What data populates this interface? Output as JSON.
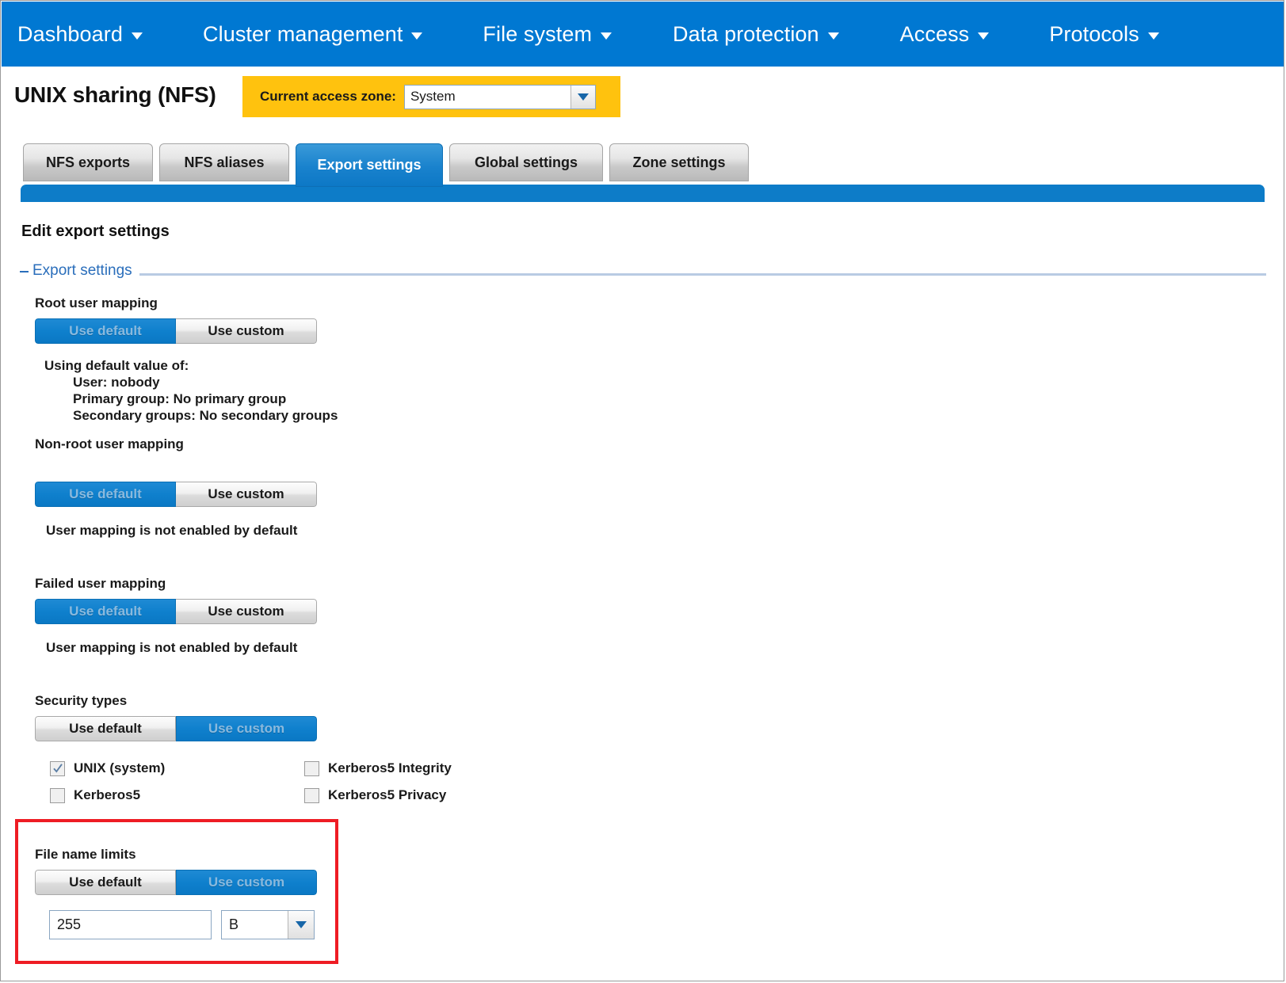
{
  "nav": {
    "items": [
      {
        "label": "Dashboard",
        "icon": "chevron-down-icon"
      },
      {
        "label": "Cluster management",
        "icon": "chevron-down-icon"
      },
      {
        "label": "File system",
        "icon": "chevron-down-icon"
      },
      {
        "label": "Data protection",
        "icon": "chevron-down-icon"
      },
      {
        "label": "Access",
        "icon": "chevron-down-icon"
      },
      {
        "label": "Protocols",
        "icon": "chevron-down-icon"
      }
    ]
  },
  "header": {
    "title": "UNIX sharing (NFS)",
    "zone": {
      "label": "Current access zone:",
      "value": "System",
      "icon": "chevron-down-icon"
    }
  },
  "tabs": [
    {
      "label": "NFS exports",
      "active": false
    },
    {
      "label": "NFS aliases",
      "active": false
    },
    {
      "label": "Export settings",
      "active": true
    },
    {
      "label": "Global settings",
      "active": false
    },
    {
      "label": "Zone settings",
      "active": false
    }
  ],
  "main": {
    "heading": "Edit export settings",
    "fieldset_legend": "Export settings",
    "toggle": {
      "default_label": "Use default",
      "custom_label": "Use custom"
    },
    "sections": {
      "root_user_mapping": {
        "label": "Root user mapping",
        "selected": "Use default",
        "helper_lines": [
          "Using default value of:",
          "User: nobody",
          "Primary group: No primary group",
          "Secondary groups: No secondary groups"
        ]
      },
      "non_root_user_mapping": {
        "label": "Non-root user mapping",
        "selected": "Use default",
        "helper": "User mapping is not enabled by default"
      },
      "failed_user_mapping": {
        "label": "Failed user mapping",
        "selected": "Use default",
        "helper": "User mapping is not enabled by default"
      },
      "security_types": {
        "label": "Security types",
        "selected": "Use custom",
        "options": [
          {
            "label": "UNIX (system)",
            "checked": true
          },
          {
            "label": "Kerberos5",
            "checked": false
          },
          {
            "label": "Kerberos5 Integrity",
            "checked": false
          },
          {
            "label": "Kerberos5 Privacy",
            "checked": false
          }
        ]
      },
      "file_name_limits": {
        "label": "File name limits",
        "selected": "Use custom",
        "value": "255",
        "unit": "B",
        "unit_icon": "chevron-down-icon",
        "highlighted": true
      }
    }
  },
  "colors": {
    "nav_blue": "#0078d2",
    "zone_yellow": "#ffc20e",
    "active_tab_blue": "#0d78c6",
    "legend_blue": "#2a6ebb",
    "highlight_red": "#ee1c24"
  }
}
